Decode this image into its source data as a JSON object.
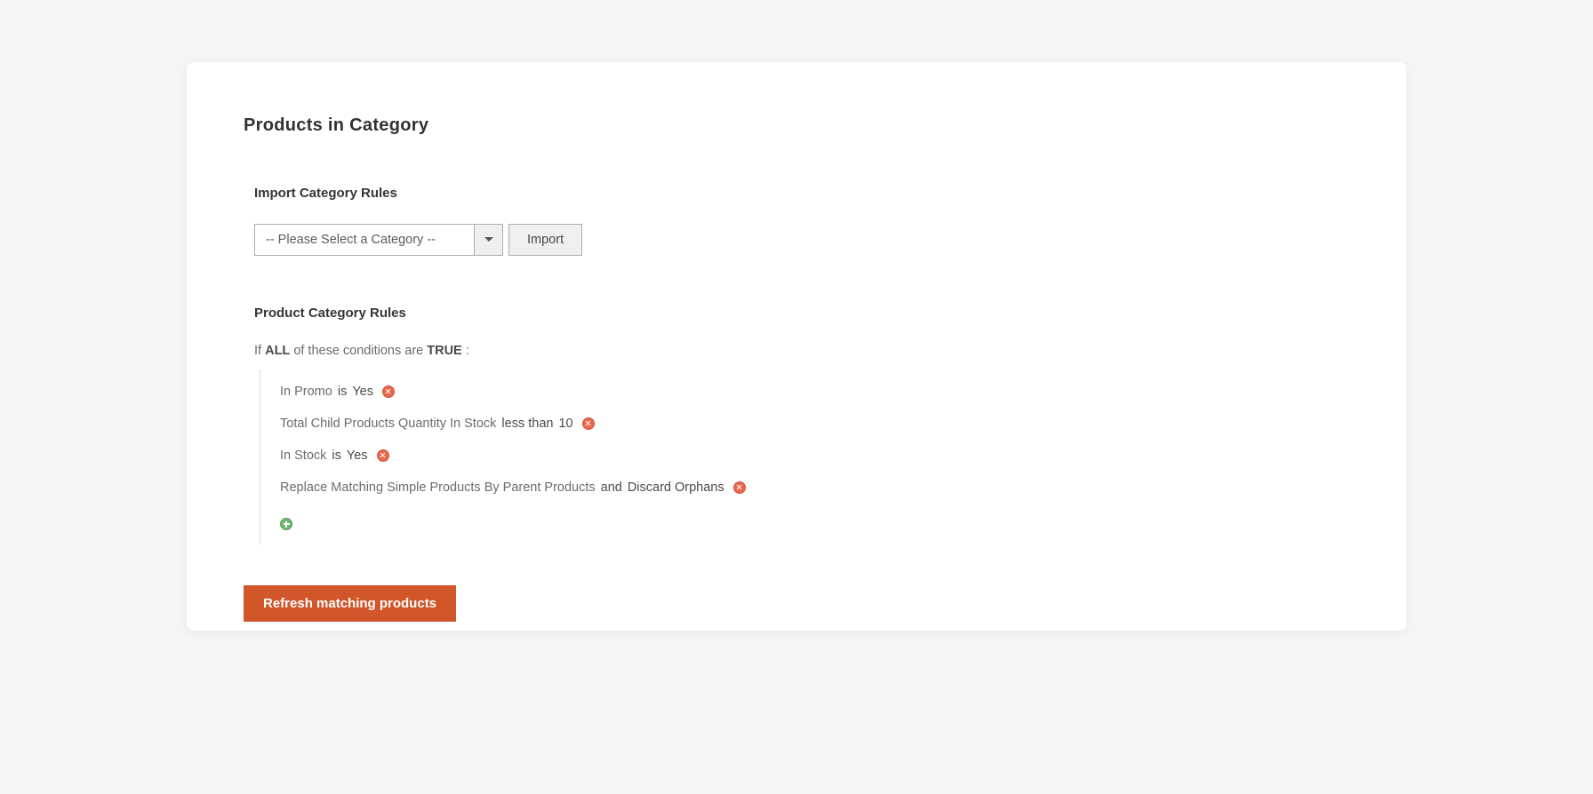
{
  "section": {
    "title": "Products in Category"
  },
  "import": {
    "heading": "Import Category Rules",
    "select_placeholder": "-- Please Select a Category --",
    "button_label": "Import"
  },
  "rules": {
    "heading": "Product Category Rules",
    "intro": {
      "prefix": "If",
      "aggregator": "ALL",
      "mid": "of these conditions are",
      "value": "TRUE",
      "suffix": ":"
    },
    "conditions": [
      {
        "attribute": "In Promo",
        "operator": "is",
        "value": "Yes"
      },
      {
        "attribute": "Total Child Products Quantity In Stock",
        "operator": "less than",
        "value": "10"
      },
      {
        "attribute": "In Stock",
        "operator": "is",
        "value": "Yes"
      },
      {
        "attribute": "Replace Matching Simple Products By Parent Products",
        "operator": "and",
        "value": "Discard Orphans"
      }
    ]
  },
  "actions": {
    "refresh_label": "Refresh matching products"
  }
}
